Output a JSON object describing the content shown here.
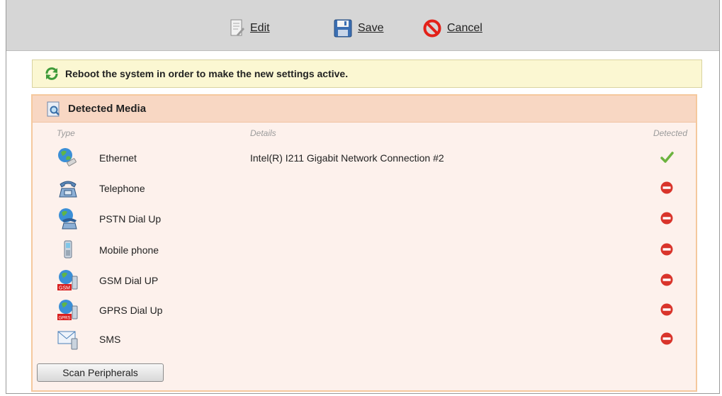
{
  "toolbar": {
    "edit_label": "Edit",
    "save_label": "Save",
    "cancel_label": "Cancel"
  },
  "notice": {
    "text": "Reboot the system in order to make the new settings active."
  },
  "panel": {
    "title": "Detected Media",
    "columns": {
      "type": "Type",
      "details": "Details",
      "detected": "Detected"
    },
    "rows": [
      {
        "type": "Ethernet",
        "details": "Intel(R) I211 Gigabit Network Connection #2",
        "icon": "ethernet-globe-icon",
        "detected": true
      },
      {
        "type": "Telephone",
        "details": "",
        "icon": "telephone-icon",
        "detected": false
      },
      {
        "type": "PSTN Dial Up",
        "details": "",
        "icon": "pstn-globe-phone-icon",
        "detected": false
      },
      {
        "type": "Mobile phone",
        "details": "",
        "icon": "mobile-phone-icon",
        "detected": false
      },
      {
        "type": "GSM Dial UP",
        "details": "",
        "icon": "gsm-globe-icon",
        "detected": false,
        "badge": "GSM"
      },
      {
        "type": "GPRS Dial Up",
        "details": "",
        "icon": "gprs-globe-icon",
        "detected": false,
        "badge": "GPRS"
      },
      {
        "type": "SMS",
        "details": "",
        "icon": "sms-envelope-icon",
        "detected": false
      }
    ],
    "scan_button": "Scan Peripherals"
  },
  "colors": {
    "toolbar_bg": "#d6d6d6",
    "notice_bg": "#fbf7d2",
    "panel_bg": "#fdf1ec",
    "panel_header_bg": "#f8d7c3",
    "detected_green": "#6cb33f",
    "not_detected_red": "#d9342b"
  }
}
